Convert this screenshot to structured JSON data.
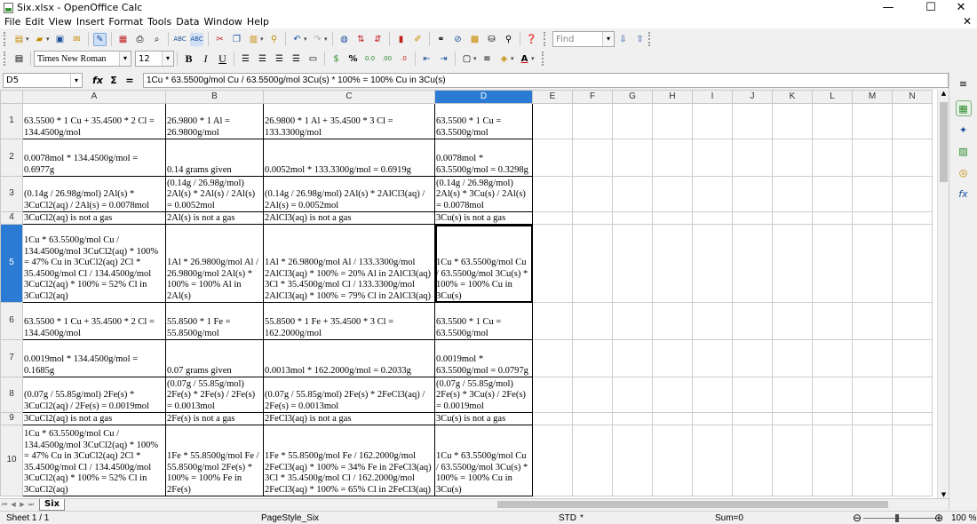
{
  "window": {
    "title": "Six.xlsx - OpenOffice Calc",
    "minimize": "—",
    "maximize": "☐",
    "close": "✕"
  },
  "menu": [
    "File",
    "Edit",
    "View",
    "Insert",
    "Format",
    "Tools",
    "Data",
    "Window",
    "Help"
  ],
  "doc_close": "✕",
  "toolbar1": {
    "icons": [
      "new-icon",
      "open-icon",
      "save-icon",
      "email-icon",
      "edit-file-icon",
      "export-pdf-icon",
      "print-icon",
      "page-preview-icon",
      "spellcheck-icon",
      "autospellcheck-icon",
      "cut-icon",
      "copy-icon",
      "paste-icon",
      "clone-formatting-icon",
      "undo-icon",
      "redo-icon",
      "hyperlink-icon",
      "sort-ascending-icon",
      "sort-descending-icon",
      "chart-icon",
      "show-draw-functions-icon",
      "find-replace-icon",
      "navigator-icon",
      "gallery-icon",
      "datasources-icon",
      "zoom-icon",
      "help-icon"
    ],
    "find_placeholder": "Find"
  },
  "toolbar2": {
    "font_name": "Times New Roman",
    "font_size": "12",
    "icons": [
      "bold-icon",
      "italic-icon",
      "underline-icon",
      "align-left-icon",
      "align-center-icon",
      "align-right-icon",
      "justify-icon",
      "merge-cells-icon",
      "currency-icon",
      "percent-icon",
      "standard-number-icon",
      "add-decimal-icon",
      "delete-decimal-icon",
      "decrease-indent-icon",
      "increase-indent-icon",
      "borders-icon",
      "line-style-icon",
      "background-color-icon",
      "font-color-icon"
    ],
    "labels": {
      "bold": "B",
      "italic": "I",
      "underline": "U",
      "percent": "%",
      "font_color": "A"
    }
  },
  "formula_bar": {
    "name_box": "D5",
    "fx": "fx",
    "sum": "Σ",
    "equals": "=",
    "content": "1Cu * 63.5500g/mol Cu / 63.5500g/mol 3Cu(s) * 100% = 100% Cu in 3Cu(s)"
  },
  "columns": [
    "A",
    "B",
    "C",
    "D",
    "E",
    "F",
    "G",
    "H",
    "I",
    "J",
    "K",
    "L",
    "M",
    "N"
  ],
  "active_column": "D",
  "active_row": "5",
  "rows": [
    {
      "num": "1",
      "cells": [
        "63.5500 * 1 Cu + 35.4500 * 2 Cl = 134.4500g/mol",
        "26.9800 * 1 Al = 26.9800g/mol",
        "26.9800 * 1 Al + 35.4500 * 3 Cl = 133.3300g/mol",
        "63.5500 * 1 Cu = 63.5500g/mol"
      ]
    },
    {
      "num": "2",
      "cells": [
        "0.0078mol * 134.4500g/mol = 0.6977g",
        "0.14 grams given",
        "0.0052mol * 133.3300g/mol = 0.6919g",
        "0.0078mol * 63.5500g/mol = 0.3298g"
      ]
    },
    {
      "num": "3",
      "cells": [
        "(0.14g / 26.98g/mol) 2Al(s) * 3CuCl2(aq) / 2Al(s) = 0.0078mol",
        "(0.14g / 26.98g/mol) 2Al(s) * 2Al(s) / 2Al(s) = 0.0052mol",
        "(0.14g / 26.98g/mol) 2Al(s) * 2AlCl3(aq) / 2Al(s) = 0.0052mol",
        "(0.14g / 26.98g/mol) 2Al(s) * 3Cu(s) / 2Al(s) = 0.0078mol"
      ]
    },
    {
      "num": "4",
      "cells": [
        "3CuCl2(aq) is not a gas",
        "2Al(s) is not a gas",
        "2AlCl3(aq) is not a gas",
        "3Cu(s) is not a gas"
      ]
    },
    {
      "num": "5",
      "cells": [
        "1Cu * 63.5500g/mol Cu / 134.4500g/mol 3CuCl2(aq) * 100% = 47% Cu in 3CuCl2(aq) 2Cl * 35.4500g/mol Cl / 134.4500g/mol 3CuCl2(aq) * 100% = 52% Cl in 3CuCl2(aq)",
        "1Al * 26.9800g/mol Al / 26.9800g/mol 2Al(s) * 100% = 100% Al in 2Al(s)",
        "1Al * 26.9800g/mol Al / 133.3300g/mol 2AlCl3(aq) * 100% = 20% Al in 2AlCl3(aq) 3Cl * 35.4500g/mol Cl / 133.3300g/mol 2AlCl3(aq) * 100% = 79% Cl in 2AlCl3(aq)",
        "1Cu * 63.5500g/mol Cu / 63.5500g/mol 3Cu(s) * 100% = 100% Cu in 3Cu(s)"
      ]
    },
    {
      "num": "6",
      "cells": [
        "63.5500 * 1 Cu + 35.4500 * 2 Cl = 134.4500g/mol",
        "55.8500 * 1 Fe = 55.8500g/mol",
        "55.8500 * 1 Fe + 35.4500 * 3 Cl = 162.2000g/mol",
        "63.5500 * 1 Cu = 63.5500g/mol"
      ]
    },
    {
      "num": "7",
      "cells": [
        "0.0019mol * 134.4500g/mol = 0.1685g",
        "0.07 grams given",
        "0.0013mol * 162.2000g/mol = 0.2033g",
        "0.0019mol * 63.5500g/mol = 0.0797g"
      ]
    },
    {
      "num": "8",
      "cells": [
        "(0.07g / 55.85g/mol) 2Fe(s) * 3CuCl2(aq) / 2Fe(s) = 0.0019mol",
        "(0.07g / 55.85g/mol) 2Fe(s) * 2Fe(s) / 2Fe(s) = 0.0013mol",
        "(0.07g / 55.85g/mol) 2Fe(s) * 2FeCl3(aq) / 2Fe(s) = 0.0013mol",
        "(0.07g / 55.85g/mol) 2Fe(s) * 3Cu(s) / 2Fe(s) = 0.0019mol"
      ]
    },
    {
      "num": "9",
      "cells": [
        "3CuCl2(aq) is not a gas",
        "2Fe(s) is not a gas",
        "2FeCl3(aq) is not a gas",
        "3Cu(s) is not a gas"
      ]
    },
    {
      "num": "10",
      "cells": [
        "1Cu * 63.5500g/mol Cu / 134.4500g/mol 3CuCl2(aq) * 100% = 47% Cu in 3CuCl2(aq) 2Cl * 35.4500g/mol Cl / 134.4500g/mol 3CuCl2(aq) * 100% = 52% Cl in 3CuCl2(aq)",
        "1Fe * 55.8500g/mol Fe / 55.8500g/mol 2Fe(s) * 100% = 100% Fe in 2Fe(s)",
        "1Fe * 55.8500g/mol Fe / 162.2000g/mol 2FeCl3(aq) * 100% = 34% Fe in 2FeCl3(aq) 3Cl * 35.4500g/mol Cl / 162.2000g/mol 2FeCl3(aq) * 100% = 65% Cl in 2FeCl3(aq)",
        "1Cu * 63.5500g/mol Cu / 63.5500g/mol 3Cu(s) * 100% = 100% Cu in 3Cu(s)"
      ]
    }
  ],
  "sheet_tab": "Six",
  "status": {
    "sheet": "Sheet 1 / 1",
    "page_style": "PageStyle_Six",
    "mode": "STD",
    "modified": "*",
    "sum": "Sum=0",
    "zoom": "100 %",
    "zoom_out": "⊖",
    "zoom_in": "⊕"
  }
}
